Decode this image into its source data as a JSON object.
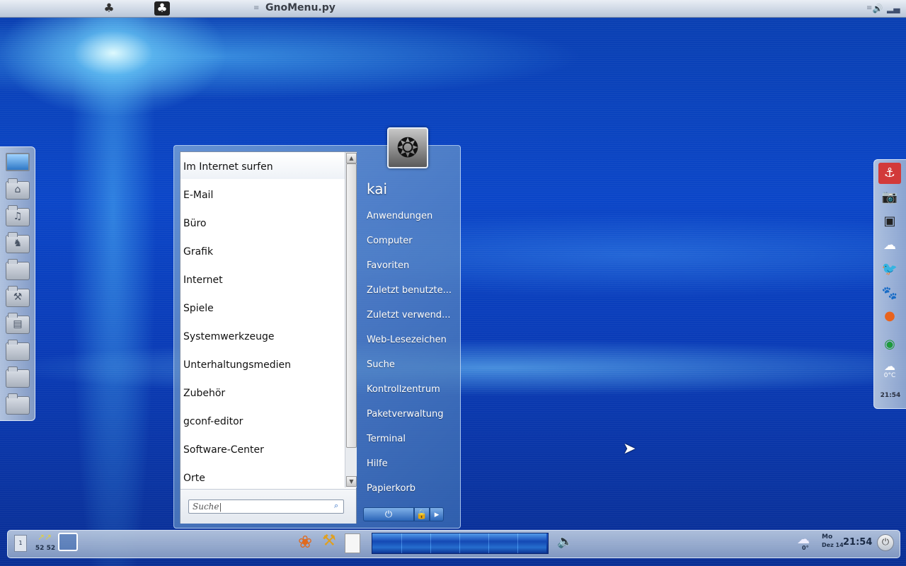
{
  "top_panel": {
    "title": "GnoMenu.py"
  },
  "start_menu": {
    "categories": [
      "Im Internet surfen",
      "E-Mail",
      "Büro",
      "Grafik",
      "Internet",
      "Spiele",
      "Systemwerkzeuge",
      "Unterhaltungsmedien",
      "Zubehör",
      "gconf-editor",
      "Software-Center",
      "Orte"
    ],
    "search_value": "Suche|",
    "user_name": "kai",
    "places": [
      "Anwendungen",
      "Computer",
      "Favoriten",
      "Zuletzt benutzte...",
      "Zuletzt verwend...",
      "Web-Lesezeichen",
      "Suche",
      "Kontrollzentrum",
      "Paketverwaltung",
      "Terminal",
      "Hilfe",
      "Papierkorb"
    ]
  },
  "right_dock": {
    "weather_temp": "0°C",
    "clock": "21:54"
  },
  "bottom_panel": {
    "workspace_number": "1",
    "cpu_text": "52 52",
    "weather_temp": "0°",
    "day": "Mo",
    "date": "Dez 14",
    "time": "21:54"
  },
  "colors": {
    "accent": "#0b46c8",
    "menu_place_text": "#ffffff"
  }
}
